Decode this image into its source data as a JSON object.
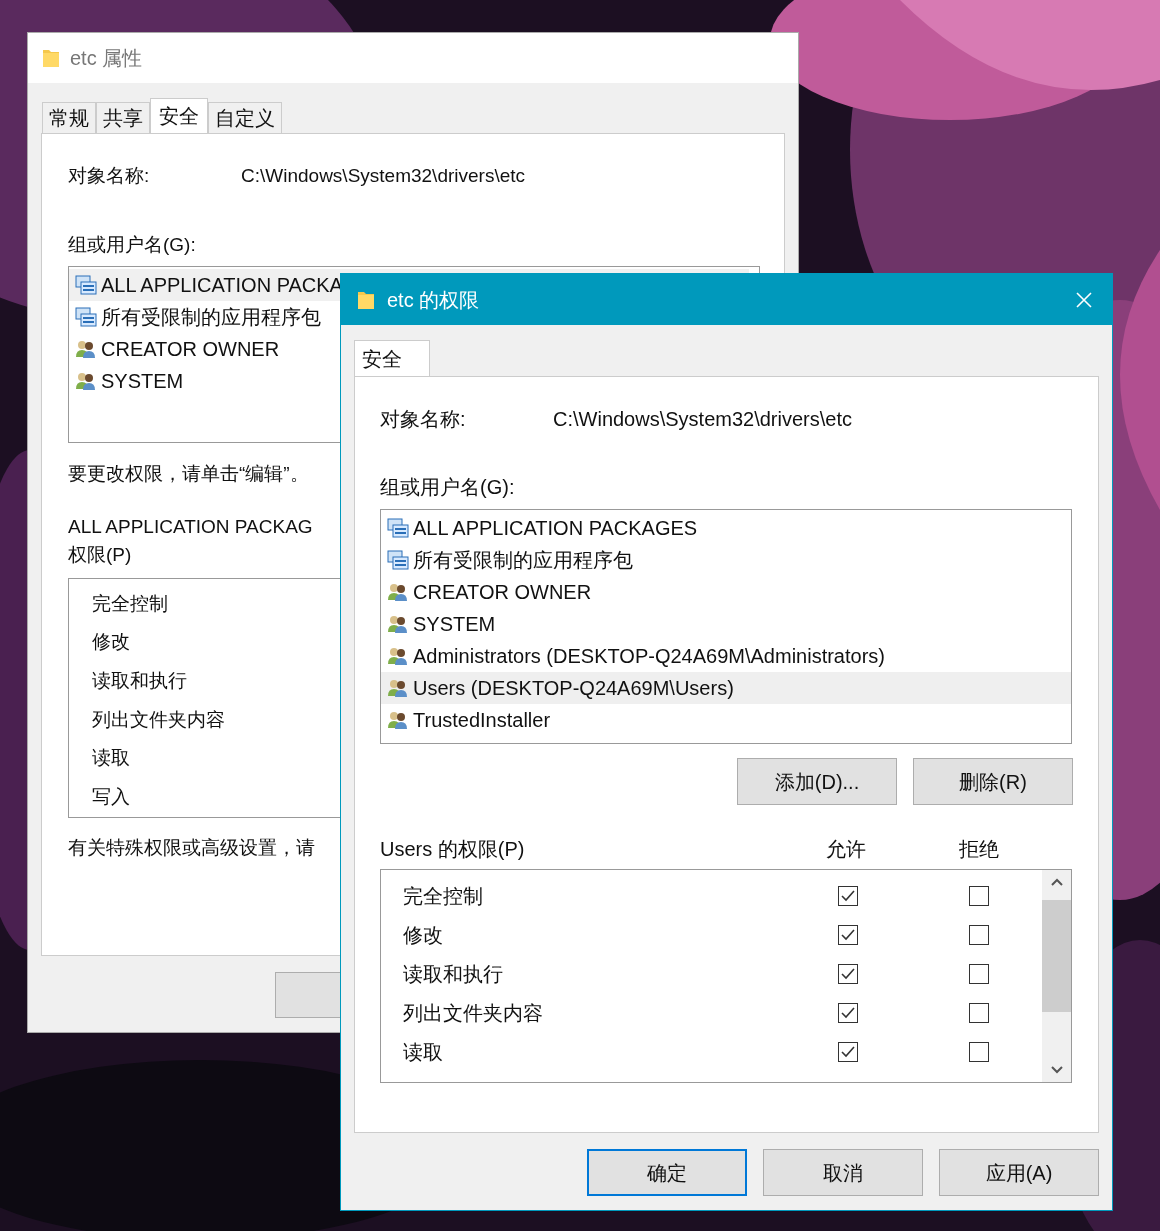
{
  "back_window": {
    "title": "etc 属性",
    "tabs": [
      {
        "label": "常规",
        "selected": false
      },
      {
        "label": "共享",
        "selected": false
      },
      {
        "label": "安全",
        "selected": true
      },
      {
        "label": "自定义",
        "selected": false
      }
    ],
    "object_label": "对象名称:",
    "object_value": "C:\\Windows\\System32\\drivers\\etc",
    "group_label": "组或用户名(G):",
    "groups": [
      {
        "name": "ALL APPLICATION PACKA",
        "kind": "package",
        "selected": true
      },
      {
        "name": "所有受限制的应用程序包",
        "kind": "package",
        "selected": false
      },
      {
        "name": "CREATOR OWNER",
        "kind": "group",
        "selected": false
      },
      {
        "name": "SYSTEM",
        "kind": "group",
        "selected": false
      }
    ],
    "edit_hint": "要更改权限，请单击“编辑”。",
    "perm_title": "ALL APPLICATION PACKAG",
    "perm_label": "权限(P)",
    "permissions": [
      "完全控制",
      "修改",
      "读取和执行",
      "列出文件夹内容",
      "读取",
      "写入"
    ],
    "advanced_hint": "有关特殊权限或高级设置，请"
  },
  "front_window": {
    "title": "etc 的权限",
    "tabs": [
      {
        "label": "安全",
        "selected": true
      }
    ],
    "object_label": "对象名称:",
    "object_value": "C:\\Windows\\System32\\drivers\\etc",
    "group_label": "组或用户名(G):",
    "groups": [
      {
        "name": "ALL APPLICATION PACKAGES",
        "kind": "package",
        "selected": false
      },
      {
        "name": "所有受限制的应用程序包",
        "kind": "package",
        "selected": false
      },
      {
        "name": "CREATOR OWNER",
        "kind": "group",
        "selected": false
      },
      {
        "name": "SYSTEM",
        "kind": "group",
        "selected": false
      },
      {
        "name": "Administrators (DESKTOP-Q24A69M\\Administrators)",
        "kind": "group",
        "selected": false
      },
      {
        "name": "Users (DESKTOP-Q24A69M\\Users)",
        "kind": "group",
        "selected": true
      },
      {
        "name": "TrustedInstaller",
        "kind": "group",
        "selected": false
      }
    ],
    "list_buttons": [
      "添加(D)...",
      "删除(R)"
    ],
    "perm_title": "Users 的权限(P)",
    "allow_header": "允许",
    "deny_header": "拒绝",
    "permissions": [
      {
        "name": "完全控制",
        "allow": true,
        "deny": false
      },
      {
        "name": "修改",
        "allow": true,
        "deny": false
      },
      {
        "name": "读取和执行",
        "allow": true,
        "deny": false
      },
      {
        "name": "列出文件夹内容",
        "allow": true,
        "deny": false
      },
      {
        "name": "读取",
        "allow": true,
        "deny": false
      }
    ],
    "buttons": [
      {
        "label": "确定",
        "default": true
      },
      {
        "label": "取消",
        "default": false
      },
      {
        "label": "应用(A)",
        "default": false
      }
    ]
  }
}
